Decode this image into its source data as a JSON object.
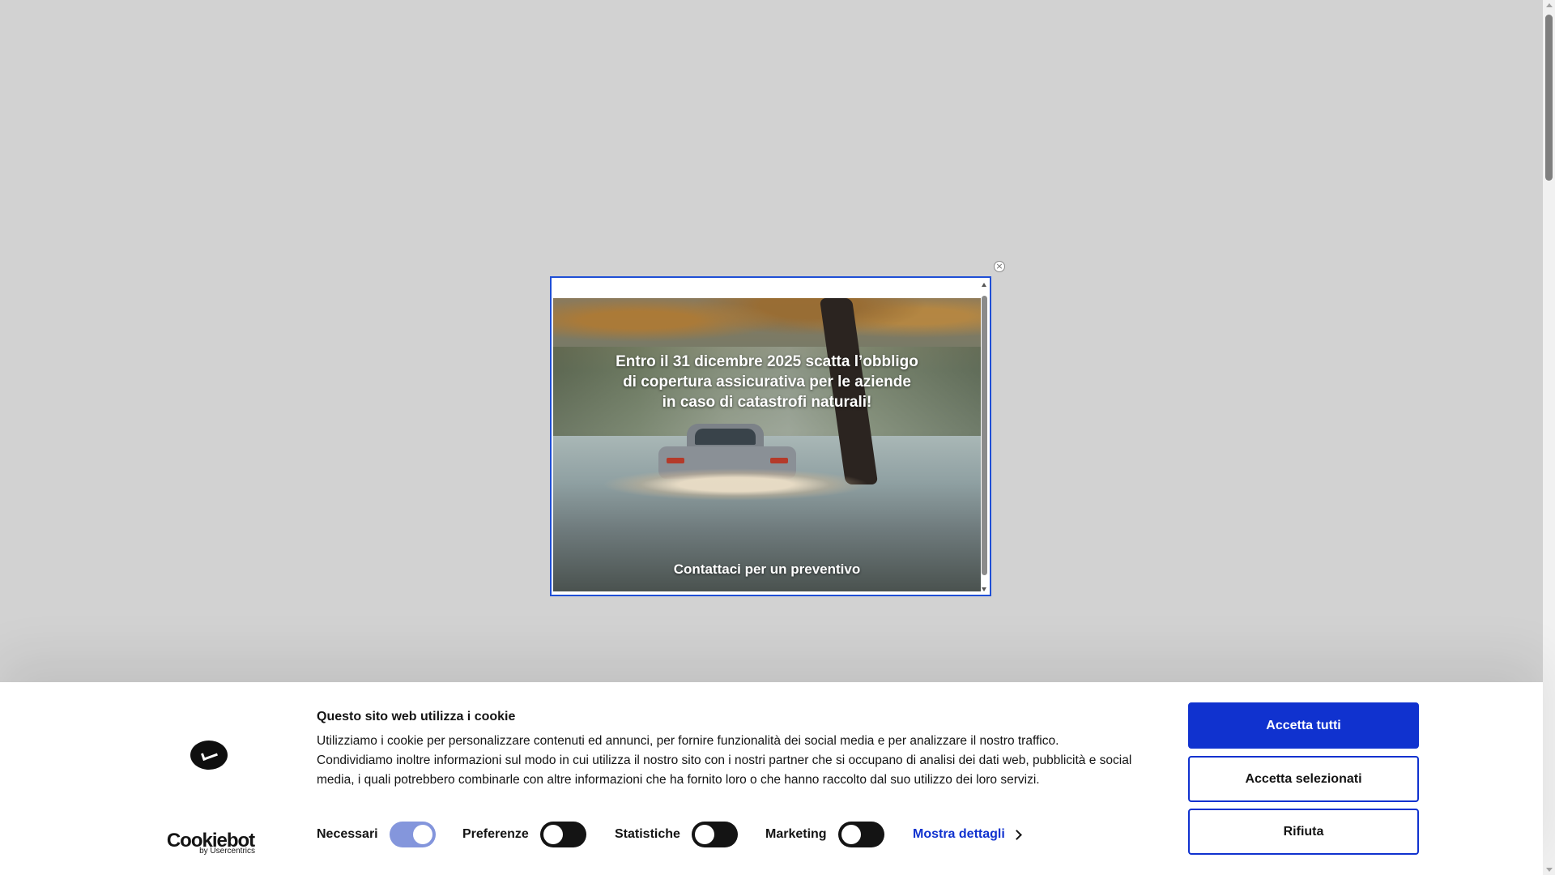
{
  "popup": {
    "headline_lines": [
      "Entro il 31 dicembre 2025 scatta l’obbligo",
      "di copertura assicurativa per le aziende",
      "in caso di catastrofi naturali!"
    ],
    "cta": "Contattaci per un preventivo",
    "close_symbol": "×"
  },
  "cookie": {
    "brand": "Cookiebot",
    "brand_byline": "by Usercentrics",
    "title": "Questo sito web utilizza i cookie",
    "text": "Utilizziamo i cookie per personalizzare contenuti ed annunci, per fornire funzionalità dei social media e per analizzare il nostro traffico. Condividiamo inoltre informazioni sul modo in cui utilizza il nostro sito con i nostri partner che si occupano di analisi dei dati web, pubblicità e social media, i quali potrebbero combinarle con altre informazioni che ha fornito loro o che hanno raccolto dal suo utilizzo dei loro servizi.",
    "toggles": [
      {
        "label": "Necessari",
        "on": true
      },
      {
        "label": "Preferenze",
        "on": false
      },
      {
        "label": "Statistiche",
        "on": false
      },
      {
        "label": "Marketing",
        "on": false
      }
    ],
    "details_link": "Mostra dettagli",
    "buttons": {
      "accept_all": "Accetta tutti",
      "accept_selected": "Accetta selezionati",
      "reject": "Rifiuta"
    },
    "colors": {
      "accent": "#1032cf",
      "text": "#141414"
    }
  }
}
